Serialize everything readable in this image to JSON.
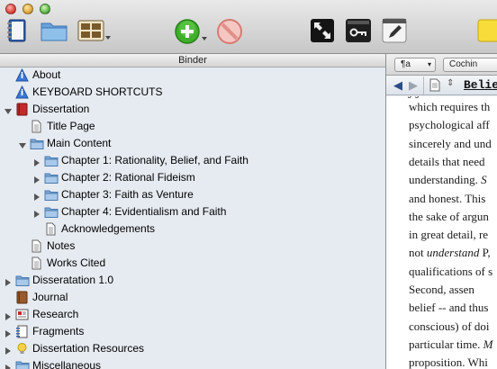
{
  "binder": {
    "header": "Binder",
    "items": [
      {
        "label": "About",
        "icon": "info-icon",
        "level": 0,
        "disclosure": "none"
      },
      {
        "label": "KEYBOARD SHORTCUTS",
        "icon": "info-icon",
        "level": 0,
        "disclosure": "none"
      },
      {
        "label": "Dissertation",
        "icon": "red-book-icon",
        "level": 0,
        "disclosure": "open"
      },
      {
        "label": "Title Page",
        "icon": "document-icon",
        "level": 1,
        "disclosure": "none"
      },
      {
        "label": "Main Content",
        "icon": "folder-icon",
        "level": 1,
        "disclosure": "open"
      },
      {
        "label": "Chapter 1: Rationality, Belief, and Faith",
        "icon": "folder-icon",
        "level": 2,
        "disclosure": "closed"
      },
      {
        "label": "Chapter 2: Rational Fideism",
        "icon": "folder-icon",
        "level": 2,
        "disclosure": "closed"
      },
      {
        "label": "Chapter 3: Faith as Venture",
        "icon": "folder-icon",
        "level": 2,
        "disclosure": "closed"
      },
      {
        "label": "Chapter 4: Evidentialism and Faith",
        "icon": "folder-icon",
        "level": 2,
        "disclosure": "closed"
      },
      {
        "label": "Acknowledgements",
        "icon": "document-icon",
        "level": 2,
        "disclosure": "none"
      },
      {
        "label": "Notes",
        "icon": "document-icon",
        "level": 1,
        "disclosure": "none"
      },
      {
        "label": "Works Cited",
        "icon": "document-icon",
        "level": 1,
        "disclosure": "none"
      },
      {
        "label": "Disseratation 1.0",
        "icon": "folder-icon",
        "level": 0,
        "disclosure": "closed"
      },
      {
        "label": "Journal",
        "icon": "brown-book-icon",
        "level": 0,
        "disclosure": "none"
      },
      {
        "label": "Research",
        "icon": "research-icon",
        "level": 0,
        "disclosure": "closed"
      },
      {
        "label": "Fragments",
        "icon": "notebook-icon",
        "level": 0,
        "disclosure": "closed"
      },
      {
        "label": "Dissertation Resources",
        "icon": "lightbulb-icon",
        "level": 0,
        "disclosure": "closed"
      },
      {
        "label": "Miscellaneous",
        "icon": "folder-icon",
        "level": 0,
        "disclosure": "closed"
      }
    ]
  },
  "format_bar": {
    "paragraph_style": "¶a",
    "font_name": "Cochin"
  },
  "editor": {
    "doc_title": "Belie",
    "lines": [
      {
        "text": "which requires th",
        "italic_part": ""
      },
      {
        "text": "psychological aff",
        "italic_part": ""
      },
      {
        "text": "sincerely and und",
        "italic_part": ""
      },
      {
        "text": "details that need",
        "italic_part": ""
      },
      {
        "text": "understanding. ",
        "italic_part": "S"
      },
      {
        "text": "and honest. This",
        "italic_part": ""
      },
      {
        "text": "the sake of argun",
        "italic_part": ""
      },
      {
        "text": "in great detail, re",
        "italic_part": ""
      },
      {
        "text": "not ",
        "italic_part": "understand",
        "tail": " P, "
      },
      {
        "text": "qualifications of s",
        "italic_part": ""
      },
      {
        "text": "   Second, assen",
        "italic_part": ""
      },
      {
        "text": "belief -- and thus",
        "italic_part": ""
      },
      {
        "text": "conscious) of doi",
        "italic_part": ""
      },
      {
        "text": "particular time. ",
        "italic_part": "M"
      },
      {
        "text": "proposition. Whi",
        "italic_part": ""
      }
    ]
  },
  "colors": {
    "binder_bg": "#e6ebf1",
    "folder_blue": "#8fb5de",
    "info_blue": "#3b78d8",
    "add_green": "#3fae2a",
    "dissertation_red": "#c22a2a"
  }
}
